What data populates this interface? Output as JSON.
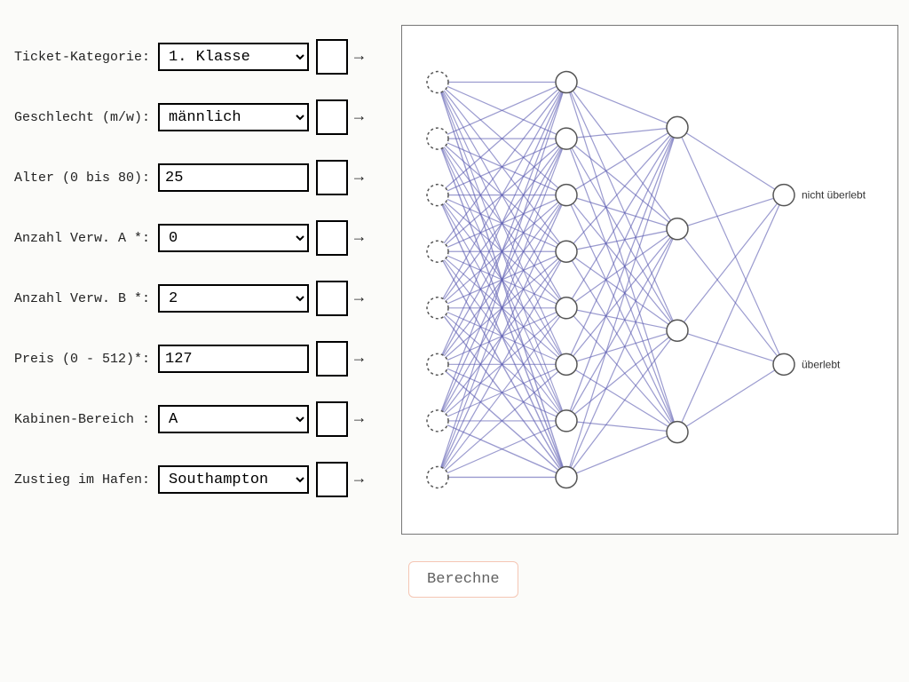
{
  "inputs": [
    {
      "id": "ticket",
      "label": "Ticket-Kategorie:",
      "type": "select",
      "value": "1. Klasse"
    },
    {
      "id": "sex",
      "label": "Geschlecht (m/w):",
      "type": "select",
      "value": "männlich"
    },
    {
      "id": "age",
      "label": "Alter (0 bis 80):",
      "type": "text",
      "value": "25"
    },
    {
      "id": "verwA",
      "label": "Anzahl Verw. A *:",
      "type": "select",
      "value": "0"
    },
    {
      "id": "verwB",
      "label": "Anzahl Verw. B *:",
      "type": "select",
      "value": "2"
    },
    {
      "id": "price",
      "label": "Preis (0 - 512)*:",
      "type": "text",
      "value": "127"
    },
    {
      "id": "cabin",
      "label": "Kabinen-Bereich :",
      "type": "select",
      "value": "A"
    },
    {
      "id": "port",
      "label": "Zustieg im Hafen:",
      "type": "select",
      "value": "Southampton"
    }
  ],
  "arrow_glyph": "→",
  "network": {
    "layers": [
      8,
      8,
      4,
      2
    ],
    "output_labels": [
      "nicht überlebt",
      "überlebt"
    ],
    "colors": {
      "pos": "#b54a57",
      "neg": "#5a5ab0"
    }
  },
  "button_label": "Berechne"
}
